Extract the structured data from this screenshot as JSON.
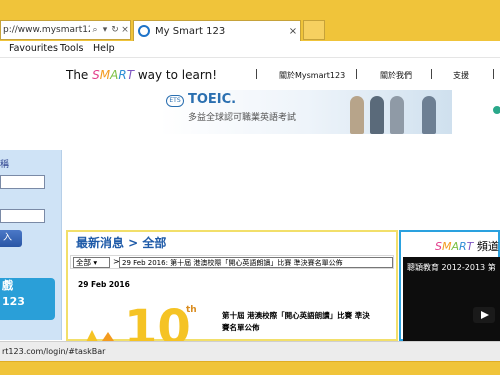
{
  "browser": {
    "address_text": "p://www.mysmart12...",
    "tab_title": "My Smart 123",
    "status_url": "rt123.com/login/#taskBar"
  },
  "menu": {
    "favourites": "Favourites",
    "tools": "Tools",
    "help": "Help"
  },
  "site": {
    "tagline_pre": "The ",
    "tagline_s": "S",
    "tagline_m": "M",
    "tagline_a": "A",
    "tagline_r": "R",
    "tagline_t": "T",
    "tagline_post": " way to learn!",
    "nav": [
      "關於Mysmart123",
      "關於我們",
      "支援"
    ]
  },
  "banner": {
    "ets": "ETS",
    "brand": "TOEIC.",
    "subtitle": "多益全球認可職業英語考試"
  },
  "login": {
    "label_username": "稱",
    "label_password": "",
    "button": "入",
    "promo_line1": "戲",
    "promo_line2": "123"
  },
  "news": {
    "header": "最新消息 > 全部",
    "filter_value": "全部",
    "item_select": "29 Feb 2016: 第十屆 港澳校際「開心英語朗讀」比賽 準決賽名單公佈",
    "date": "29 Feb 2016",
    "graphic_text": "10",
    "graphic_suffix": "th",
    "title": "第十屆 港澳校際「開心英語朗讀」比賽 準決賽名單公佈"
  },
  "smart_channel": {
    "prefix_s": "S",
    "prefix_m": "M",
    "prefix_a": "A",
    "prefix_r": "R",
    "prefix_t": "T",
    "title_rest": " 頻道",
    "video_title": "聰穎教育 2012-2013 第"
  },
  "colors": {
    "chrome": "#f0c43a",
    "link_blue": "#1e5aa8",
    "news_border": "#f2df6a",
    "channel_border": "#2aa1df"
  }
}
